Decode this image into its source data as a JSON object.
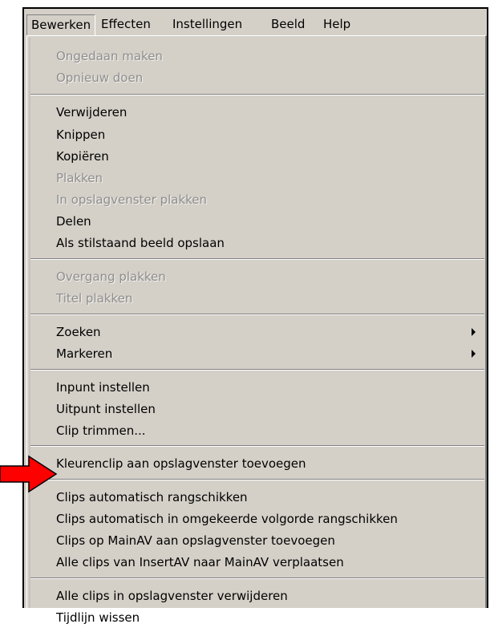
{
  "menubar": {
    "items": [
      "Bewerken",
      "Effecten",
      "Instellingen",
      "Beeld",
      "Help"
    ]
  },
  "menu": {
    "undo": "Ongedaan maken",
    "redo": "Opnieuw doen",
    "delete": "Verwijderen",
    "cut": "Knippen",
    "copy": "Kopiëren",
    "paste": "Plakken",
    "paste_in_storyboard": "In opslagvenster plakken",
    "split": "Delen",
    "save_still": "Als stilstaand beeld opslaan",
    "paste_transition": "Overgang plakken",
    "paste_title": "Titel plakken",
    "find": "Zoeken",
    "mark": "Markeren",
    "set_in": "Inpunt instellen",
    "set_out": "Uitpunt instellen",
    "trim_clip": "Clip trimmen...",
    "add_color_clip": "Kleurenclip aan opslagvenster toevoegen",
    "auto_arrange": "Clips automatisch rangschikken",
    "auto_arrange_reverse": "Clips automatisch in omgekeerde volgorde rangschikken",
    "add_mainav_clips": "Clips op MainAV aan opslagvenster toevoegen",
    "move_insertav": "Alle clips van InsertAV naar MainAV verplaatsen",
    "delete_all_storyboard": "Alle clips in opslagvenster verwijderen",
    "clear_timeline": "Tijdlijn wissen"
  },
  "colors": {
    "menu_bg": "#d4d0c8",
    "disabled_text": "#8e8e8e",
    "pointer_arrow": "#ff0000"
  }
}
